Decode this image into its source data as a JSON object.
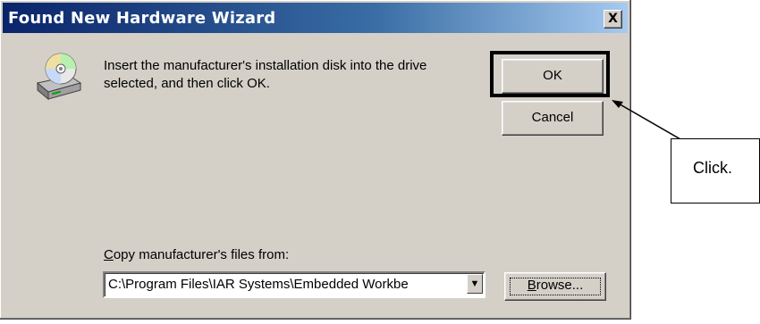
{
  "window": {
    "title": "Found New Hardware Wizard",
    "close_label": "X"
  },
  "icon": "disk-drive-icon",
  "message": {
    "line1": "Insert the manufacturer's installation disk into the drive",
    "line2": "selected, and then click OK."
  },
  "buttons": {
    "ok": "OK",
    "cancel": "Cancel",
    "browse_mnemonic": "B",
    "browse_rest": "rowse..."
  },
  "copy_from": {
    "label_mnemonic": "C",
    "label_rest": "opy manufacturer's files from:",
    "value": "C:\\Program Files\\IAR Systems\\Embedded Workbe"
  },
  "annotation": {
    "callout_text": "Click."
  }
}
